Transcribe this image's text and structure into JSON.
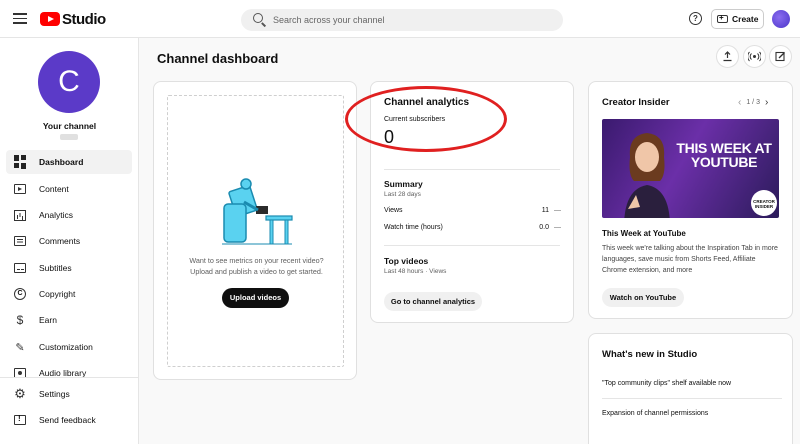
{
  "header": {
    "logo_text": "Studio",
    "search_placeholder": "Search across your channel",
    "create_label": "Create",
    "help_glyph": "?"
  },
  "sidebar": {
    "avatar_letter": "C",
    "channel_name": "Your channel",
    "items": [
      {
        "label": "Dashboard",
        "icon": "dashboard-icon",
        "active": true
      },
      {
        "label": "Content",
        "icon": "content-icon"
      },
      {
        "label": "Analytics",
        "icon": "analytics-icon"
      },
      {
        "label": "Comments",
        "icon": "comments-icon"
      },
      {
        "label": "Subtitles",
        "icon": "subtitles-icon"
      },
      {
        "label": "Copyright",
        "icon": "copyright-icon"
      },
      {
        "label": "Earn",
        "icon": "earn-icon"
      },
      {
        "label": "Customization",
        "icon": "customization-icon"
      },
      {
        "label": "Audio library",
        "icon": "audio-library-icon"
      }
    ],
    "bottom_items": [
      {
        "label": "Settings",
        "icon": "settings-icon"
      },
      {
        "label": "Send feedback",
        "icon": "feedback-icon"
      }
    ]
  },
  "main": {
    "title": "Channel dashboard",
    "upload_card": {
      "text_line1": "Want to see metrics on your recent video?",
      "text_line2": "Upload and publish a video to get started.",
      "button": "Upload videos"
    },
    "analytics_card": {
      "title": "Channel analytics",
      "subscribers_label": "Current subscribers",
      "subscribers_value": "0",
      "summary_title": "Summary",
      "summary_period": "Last 28 days",
      "rows": [
        {
          "label": "Views",
          "value": "11",
          "trend": "—"
        },
        {
          "label": "Watch time (hours)",
          "value": "0.0",
          "trend": "—"
        }
      ],
      "top_videos_title": "Top videos",
      "top_videos_sub": "Last 48 hours · Views",
      "button": "Go to channel analytics"
    },
    "creator_insider": {
      "title": "Creator Insider",
      "pager": "1 / 3",
      "thumb_text_1": "THIS WEEK AT",
      "thumb_text_2": "YOUTUBE",
      "badge_line1": "CREATOR",
      "badge_line2": "INSIDER",
      "video_title": "This Week at YouTube",
      "description": "This week we're talking about the Inspiration Tab in more languages, save music from Shorts Feed, Affiliate Chrome extension, and more",
      "button": "Watch on YouTube"
    },
    "whats_new": {
      "title": "What's new in Studio",
      "items": [
        "\"Top community clips\" shelf available now",
        "Expansion of channel permissions"
      ]
    }
  },
  "colors": {
    "brand_red": "#ff0000",
    "avatar_purple": "#5b3ac8",
    "annotation_red": "#e02020"
  }
}
